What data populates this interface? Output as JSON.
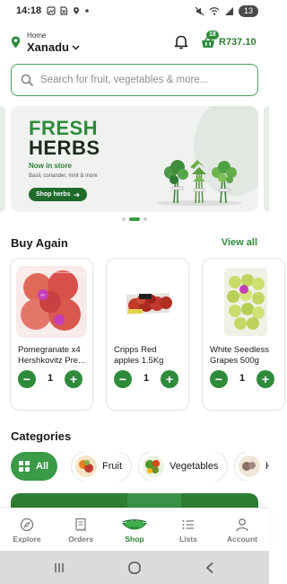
{
  "status_bar": {
    "time": "14:18",
    "battery": "13"
  },
  "header": {
    "location_label": "Home",
    "location_name": "Xanadu",
    "cart_count": "18",
    "cart_total": "R737.10"
  },
  "search": {
    "placeholder": "Search for fruit, vegetables & more..."
  },
  "banner": {
    "title_line1": "FRESH",
    "title_line2": "HERBS",
    "tagline": "Now in store",
    "subtext": "Basil, coriander, mint & more",
    "cta_label": "Shop herbs",
    "active_slide": 2,
    "slide_count": 3
  },
  "buy_again": {
    "title": "Buy Again",
    "view_all_label": "View all",
    "products": [
      {
        "name_line1": "Pomegranate x4",
        "name_line2": "Hershkovitz Pre...",
        "qty": "1"
      },
      {
        "name_line1": "Cripps Red",
        "name_line2": "apples 1.5Kg",
        "qty": "1"
      },
      {
        "name_line1": "White Seedless",
        "name_line2": "Grapes 500g",
        "qty": "1"
      }
    ]
  },
  "categories": {
    "title": "Categories",
    "items": [
      {
        "label": "All",
        "active": true
      },
      {
        "label": "Fruit",
        "active": false
      },
      {
        "label": "Vegetables",
        "active": false
      },
      {
        "label": "H",
        "active": false
      }
    ]
  },
  "bottom_nav": {
    "items": [
      {
        "label": "Explore",
        "icon": "compass-icon"
      },
      {
        "label": "Orders",
        "icon": "receipt-icon"
      },
      {
        "label": "Shop",
        "icon": "peas-icon",
        "active": true
      },
      {
        "label": "Lists",
        "icon": "list-icon"
      },
      {
        "label": "Account",
        "icon": "person-icon"
      }
    ]
  },
  "colors": {
    "brand_green": "#2e8b3a",
    "dark_green": "#1f6b2c",
    "text": "#1a1a1a"
  }
}
